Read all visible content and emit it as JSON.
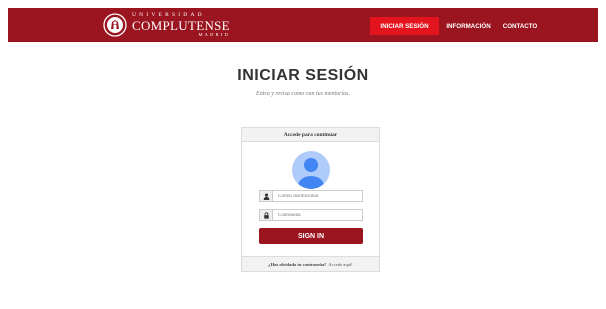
{
  "brand": {
    "line1": "UNIVERSIDAD",
    "line2": "COMPLUTENSE",
    "line3": "MADRID"
  },
  "nav": {
    "items": [
      {
        "label": "INICIAR SESIÓN",
        "active": true
      },
      {
        "label": "INFORMACIÓN",
        "active": false
      },
      {
        "label": "CONTACTO",
        "active": false
      }
    ]
  },
  "page": {
    "title": "INICIAR SESIÓN",
    "subtitle": "Entra y revisa como van tus mentorías."
  },
  "login": {
    "header": "Accede para continuar",
    "email_placeholder": "Correo Institucional",
    "password_placeholder": "Contraseña",
    "submit_label": "SIGN IN",
    "forgot_question": "¿Has olvidado tu contraseña?",
    "forgot_link": "Accede aquí!"
  },
  "colors": {
    "brand": "#9b1520",
    "nav_active": "#e4141f",
    "avatar": "#4285f4",
    "avatar_bg": "#aecbfa"
  },
  "icons": {
    "user": "user-icon",
    "lock": "lock-icon"
  }
}
